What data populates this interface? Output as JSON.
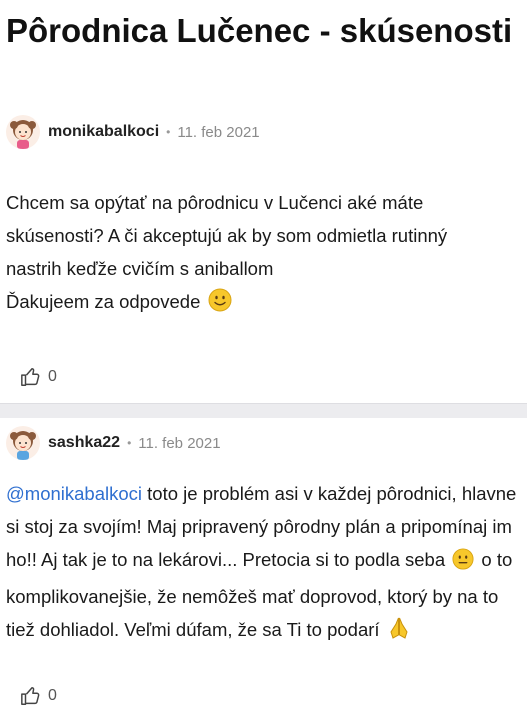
{
  "thread": {
    "title": "Pôrodnica Lučenec - skúsenosti"
  },
  "posts": [
    {
      "author": "monikabalkoci",
      "separator": "•",
      "date": "11. feb 2021",
      "lines": [
        "Chcem sa opýtať na pôrodnicu v Lučenci aké máte",
        "skúsenosti? A či akceptujú ak by som odmietla rutinný",
        "nastrih keďže cvičím s aniballom",
        "Ďakujeem za odpovede"
      ],
      "emoji": "slightly-smiling-face",
      "likes": "0"
    },
    {
      "author": "sashka22",
      "separator": "•",
      "date": "11. feb 2021",
      "mention": "@monikabalkoci",
      "text_a": " toto je problém asi v každej pôrodnici, hlavne si stoj za svojím! Maj pripravený pôrodny plán a pripomínaj im ho!! Aj tak je to na lekárovi... Pretocia si to podla seba ",
      "text_b": " o to komplikovanejšie, že nemôžeš mať doprovod, ktorý by na to tiež dohliadol. Veľmi dúfam, že sa Ti to podarí ",
      "emojis": [
        "neutral-face",
        "folded-hands"
      ],
      "likes": "0"
    }
  ],
  "colors": {
    "mention": "#2f6fd0",
    "divider": "#ececef",
    "emoji": "#f7c72b"
  }
}
